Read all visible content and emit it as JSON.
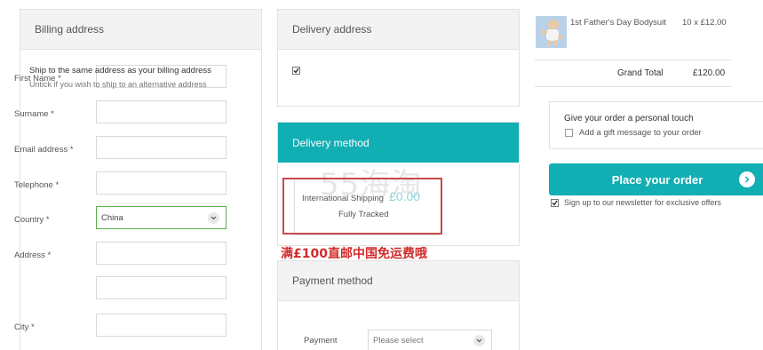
{
  "billing": {
    "title": "Billing address",
    "fields": [
      {
        "label": "First Name *",
        "value": ""
      },
      {
        "label": "Surname *",
        "value": ""
      },
      {
        "label": "Email address *",
        "value": ""
      },
      {
        "label": "Telephone *",
        "value": ""
      },
      {
        "label": "Country *",
        "value": "China"
      },
      {
        "label": "Address *",
        "value": ""
      },
      {
        "label": "",
        "value": ""
      },
      {
        "label": "City *",
        "value": ""
      }
    ]
  },
  "delivery": {
    "title": "Delivery address",
    "ship_same_label": "Ship to the same address as your billing address",
    "ship_same_checked": true,
    "ship_same_hint": "Untick if you wish to ship to an alternative address"
  },
  "delivery_method": {
    "title": "Delivery method",
    "option_name": "International Shipping",
    "option_price": "£0.00",
    "option_sub": "Fully Tracked"
  },
  "overlay": {
    "watermark": "55海淘",
    "annotation": "满£100直邮中国免运费哦"
  },
  "payment": {
    "title": "Payment method",
    "label": "Payment",
    "select_placeholder": "Please select"
  },
  "order": {
    "item_name": "1st Father's Day Bodysuit",
    "item_qty": "10 x £12.00",
    "grand_total_label": "Grand Total",
    "grand_total_value": "£120.00",
    "personal_touch_title": "Give your order a personal touch",
    "gift_label": "Add a gift message to your order",
    "gift_checked": false,
    "place_order_label": "Place your order",
    "newsletter_label": "Sign up to our newsletter for exclusive offers",
    "newsletter_checked": true
  },
  "colors": {
    "accent": "#11aeb3",
    "valid_border": "#58b04a",
    "annotation": "#d02b2b"
  }
}
